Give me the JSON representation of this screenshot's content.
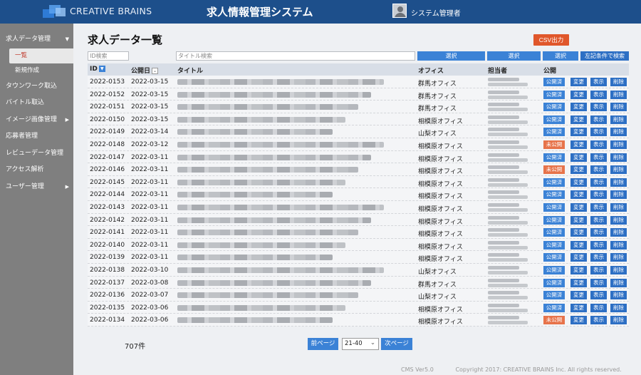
{
  "header": {
    "brand": "CREATIVE BRAINS",
    "system_title": "求人情報管理システム",
    "user_name": "システム管理者"
  },
  "sidebar": {
    "items": [
      {
        "label": "求人データ管理",
        "has_caret": true,
        "caret": "▼"
      },
      {
        "label": "一覧",
        "sub": true,
        "active": true
      },
      {
        "label": "新規作成",
        "sub": true
      },
      {
        "label": "タウンワーク取込"
      },
      {
        "label": "バイトル取込"
      },
      {
        "label": "イメージ画像管理",
        "has_caret": true,
        "caret": "▶"
      },
      {
        "label": "応募者管理"
      },
      {
        "label": "レビューデータ管理"
      },
      {
        "label": "アクセス解析"
      },
      {
        "label": "ユーザー管理",
        "has_caret": true,
        "caret": "▶"
      }
    ]
  },
  "main": {
    "page_title": "求人データ一覧",
    "csv_button": "CSV出力",
    "filters": {
      "id_placeholder": "ID検索",
      "title_placeholder": "タイトル検索",
      "select1": "選択",
      "select2": "選択",
      "select3": "選択",
      "search_button": "左記条件で検索"
    },
    "columns": {
      "id": "ID",
      "id_sort": "▼",
      "date": "公開日",
      "date_sort": "–",
      "title": "タイトル",
      "office": "オフィス",
      "person": "担当者",
      "public": "公開"
    },
    "rows": [
      {
        "id": "2022-0153",
        "date": "2022-03-15",
        "office": "群馬オフィス",
        "status": "公開済",
        "published": true
      },
      {
        "id": "2022-0152",
        "date": "2022-03-15",
        "office": "群馬オフィス",
        "status": "公開済",
        "published": true
      },
      {
        "id": "2022-0151",
        "date": "2022-03-15",
        "office": "群馬オフィス",
        "status": "公開済",
        "published": true
      },
      {
        "id": "2022-0150",
        "date": "2022-03-15",
        "office": "相模原オフィス",
        "status": "公開済",
        "published": true
      },
      {
        "id": "2022-0149",
        "date": "2022-03-14",
        "office": "山梨オフィス",
        "status": "公開済",
        "published": true
      },
      {
        "id": "2022-0148",
        "date": "2022-03-12",
        "office": "相模原オフィス",
        "status": "未公開",
        "published": false
      },
      {
        "id": "2022-0147",
        "date": "2022-03-11",
        "office": "相模原オフィス",
        "status": "公開済",
        "published": true
      },
      {
        "id": "2022-0146",
        "date": "2022-03-11",
        "office": "相模原オフィス",
        "status": "未公開",
        "published": false
      },
      {
        "id": "2022-0145",
        "date": "2022-03-11",
        "office": "相模原オフィス",
        "status": "公開済",
        "published": true
      },
      {
        "id": "2022-0144",
        "date": "2022-03-11",
        "office": "相模原オフィス",
        "status": "公開済",
        "published": true
      },
      {
        "id": "2022-0143",
        "date": "2022-03-11",
        "office": "相模原オフィス",
        "status": "公開済",
        "published": true
      },
      {
        "id": "2022-0142",
        "date": "2022-03-11",
        "office": "相模原オフィス",
        "status": "公開済",
        "published": true
      },
      {
        "id": "2022-0141",
        "date": "2022-03-11",
        "office": "相模原オフィス",
        "status": "公開済",
        "published": true
      },
      {
        "id": "2022-0140",
        "date": "2022-03-11",
        "office": "相模原オフィス",
        "status": "公開済",
        "published": true
      },
      {
        "id": "2022-0139",
        "date": "2022-03-11",
        "office": "相模原オフィス",
        "status": "公開済",
        "published": true
      },
      {
        "id": "2022-0138",
        "date": "2022-03-10",
        "office": "山梨オフィス",
        "status": "公開済",
        "published": true
      },
      {
        "id": "2022-0137",
        "date": "2022-03-08",
        "office": "群馬オフィス",
        "status": "公開済",
        "published": true
      },
      {
        "id": "2022-0136",
        "date": "2022-03-07",
        "office": "山梨オフィス",
        "status": "公開済",
        "published": true
      },
      {
        "id": "2022-0135",
        "date": "2022-03-06",
        "office": "相模原オフィス",
        "status": "公開済",
        "published": true
      },
      {
        "id": "2022-0134",
        "date": "2022-03-06",
        "office": "相模原オフィス",
        "status": "未公開",
        "published": false
      }
    ],
    "actions": {
      "edit": "変更",
      "view": "表示",
      "delete": "削除"
    },
    "total_count": "707件",
    "pager": {
      "prev": "前ページ",
      "range": "21-40",
      "range_caret": "⌄",
      "next": "次ページ"
    }
  },
  "footer": {
    "version": "CMS Ver5.0",
    "copyright": "Copyright 2017: CREATIVE BRAINS Inc. All rights reserved."
  },
  "colors": {
    "header_bg": "#1d4f8b",
    "sidebar_bg": "#7f7f7f",
    "accent_blue": "#3b82d6",
    "accent_orange": "#e0572b",
    "unpublished": "#e7734a"
  }
}
